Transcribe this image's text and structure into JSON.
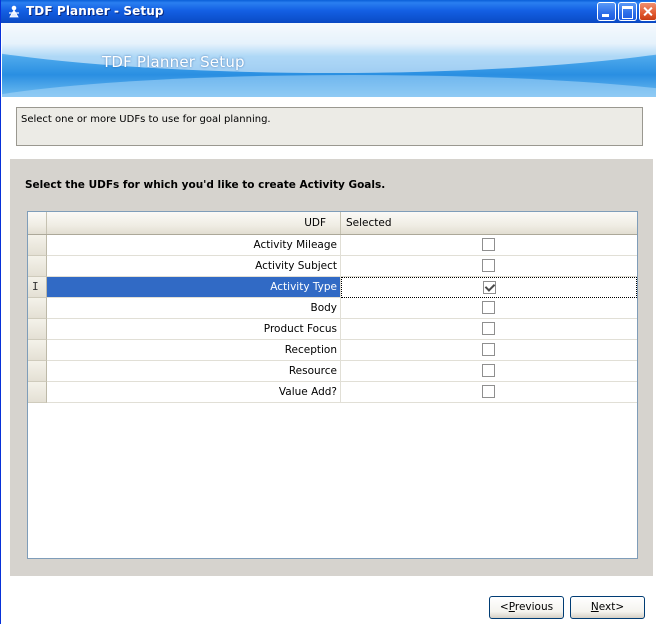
{
  "window": {
    "title": "TDF Planner - Setup"
  },
  "banner": {
    "title": "TDF Planner Setup"
  },
  "instruction": "Select one or more UDFs to use for goal planning.",
  "prompt": "Select the UDFs for which you'd like to create Activity Goals.",
  "grid": {
    "columns": [
      "UDF",
      "Selected"
    ],
    "rows": [
      {
        "udf": "Activity Mileage",
        "selected": false
      },
      {
        "udf": "Activity Subject",
        "selected": false
      },
      {
        "udf": "Activity Type",
        "selected": true,
        "current": true
      },
      {
        "udf": "Body",
        "selected": false
      },
      {
        "udf": "Product Focus",
        "selected": false
      },
      {
        "udf": "Reception",
        "selected": false
      },
      {
        "udf": "Resource",
        "selected": false
      },
      {
        "udf": "Value Add?",
        "selected": false
      }
    ]
  },
  "buttons": {
    "previous": {
      "mnemonic": "P",
      "rest": "revious"
    },
    "next": {
      "mnemonic": "N",
      "rest": "ext>"
    },
    "previous_prefix": "<"
  },
  "colors": {
    "selection": "#316ac5",
    "titlebar": "#0d52d0",
    "panel": "#d6d3ce"
  },
  "icons": {
    "app": "tdf-app-icon",
    "minimize": "minimize-icon",
    "maximize": "maximize-icon",
    "close": "close-icon",
    "text_cursor": "text-cursor-icon",
    "checkbox": "checkbox-icon"
  }
}
